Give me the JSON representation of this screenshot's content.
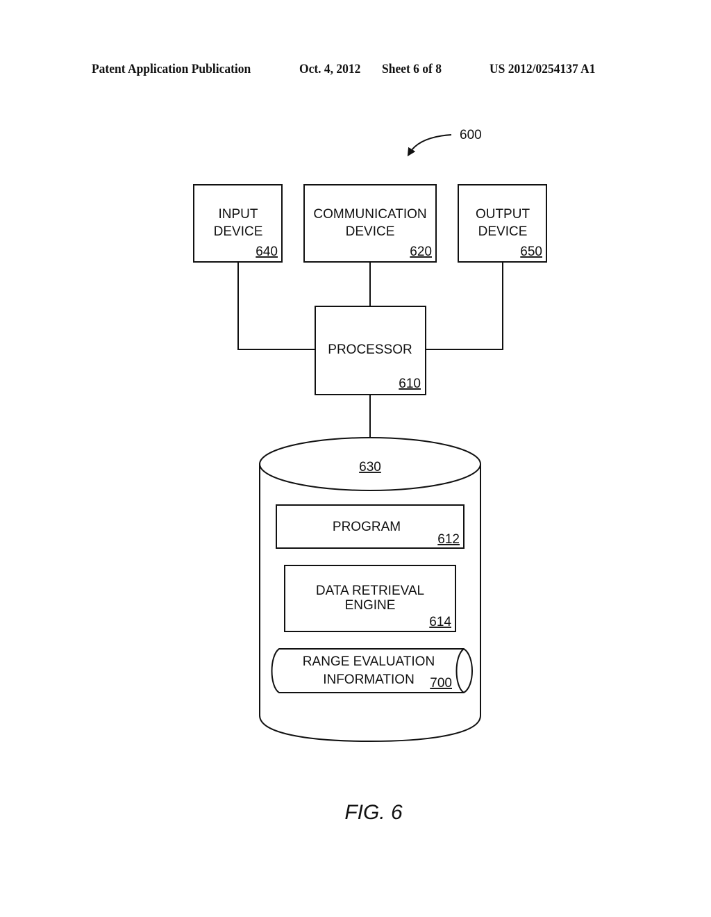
{
  "header": {
    "publication": "Patent Application Publication",
    "date": "Oct. 4, 2012",
    "sheet": "Sheet 6 of 8",
    "number": "US 2012/0254137 A1"
  },
  "figure": {
    "ref": "600",
    "caption": "FIG. 6",
    "input_device": {
      "line1": "INPUT",
      "line2": "DEVICE",
      "ref": "640"
    },
    "communication_device": {
      "line1": "COMMUNICATION",
      "line2": "DEVICE",
      "ref": "620"
    },
    "output_device": {
      "line1": "OUTPUT",
      "line2": "DEVICE",
      "ref": "650"
    },
    "processor": {
      "label": "PROCESSOR",
      "ref": "610"
    },
    "storage": {
      "ref": "630"
    },
    "program": {
      "label": "PROGRAM",
      "ref": "612"
    },
    "data_retrieval_engine": {
      "line1": "DATA RETRIEVAL",
      "line2": "ENGINE",
      "ref": "614"
    },
    "range_evaluation": {
      "line1": "RANGE EVALUATION",
      "line2": "INFORMATION",
      "ref": "700"
    }
  }
}
